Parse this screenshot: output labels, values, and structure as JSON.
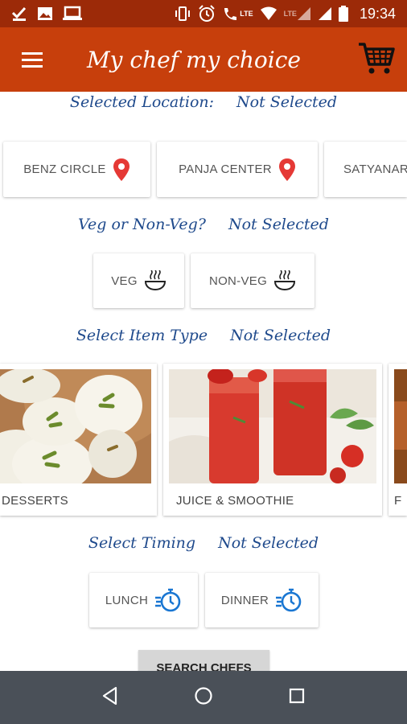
{
  "status_bar": {
    "time": "19:34",
    "lte_label": "LTE",
    "lte_label2": "LTE"
  },
  "app_bar": {
    "title": "My chef my choice"
  },
  "location": {
    "label": "Selected Location:",
    "value": "Not Selected",
    "options": [
      "BENZ CIRCLE",
      "PANJA CENTER",
      "SATYANARAYANAPURAM"
    ]
  },
  "veg": {
    "label": "Veg or Non-Veg?",
    "value": "Not Selected",
    "options": [
      "VEG",
      "NON-VEG"
    ]
  },
  "item_type": {
    "label": "Select Item Type",
    "value": "Not Selected",
    "options": [
      "DESSERTS",
      "JUICE & SMOOTHIE",
      "F"
    ]
  },
  "timing": {
    "label": "Select Timing",
    "value": "Not Selected",
    "options": [
      "LUNCH",
      "DINNER"
    ]
  },
  "search_button": "SEARCH CHEFS",
  "colors": {
    "status_bar": "#9c2a08",
    "app_bar": "#c73f0c",
    "label_blue": "#1f4a8c",
    "pin_red": "#e53935",
    "timer_blue": "#1976d2",
    "nav_bar": "#4a5058"
  }
}
